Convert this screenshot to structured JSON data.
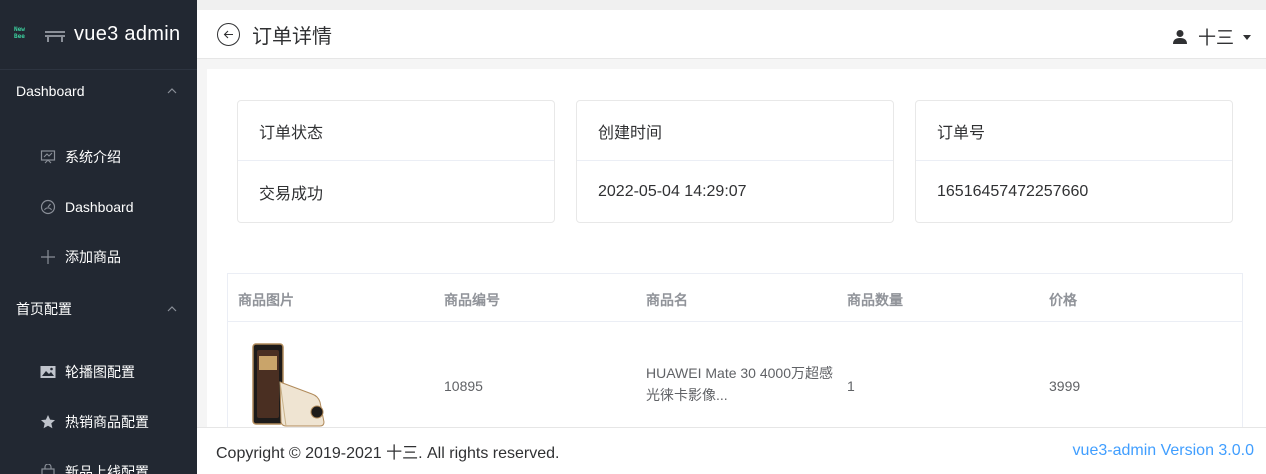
{
  "sidebar": {
    "logo_top": "New",
    "logo_bottom": "Bee",
    "title": "vue3 admin",
    "groups": [
      {
        "title": "Dashboard",
        "items": [
          {
            "label": "系统介绍",
            "icon": "monitor-icon"
          },
          {
            "label": "Dashboard",
            "icon": "odometer-icon"
          },
          {
            "label": "添加商品",
            "icon": "plus-icon"
          }
        ]
      },
      {
        "title": "首页配置",
        "items": [
          {
            "label": "轮播图配置",
            "icon": "picture-icon"
          },
          {
            "label": "热销商品配置",
            "icon": "star-icon"
          },
          {
            "label": "新品上线配置",
            "icon": "sell-icon"
          }
        ]
      }
    ]
  },
  "header": {
    "title": "订单详情",
    "user_name": "十三"
  },
  "order": {
    "status_label": "订单状态",
    "status_value": "交易成功",
    "created_label": "创建时间",
    "created_value": "2022-05-04 14:29:07",
    "order_no_label": "订单号",
    "order_no_value": "16516457472257660"
  },
  "table": {
    "columns": [
      "商品图片",
      "商品编号",
      "商品名",
      "商品数量",
      "价格"
    ],
    "rows": [
      {
        "goods_id": "10895",
        "name": "HUAWEI Mate 30 4000万超感光徕卡影像...",
        "count": "1",
        "price": "3999"
      }
    ]
  },
  "footer": {
    "copyright": "Copyright © 2019-2021 十三. All rights reserved.",
    "version": "vue3-admin Version 3.0.0"
  },
  "colors": {
    "sidebar_bg": "#222832",
    "accent": "#409eff",
    "logo_green": "#3ccf9e"
  }
}
